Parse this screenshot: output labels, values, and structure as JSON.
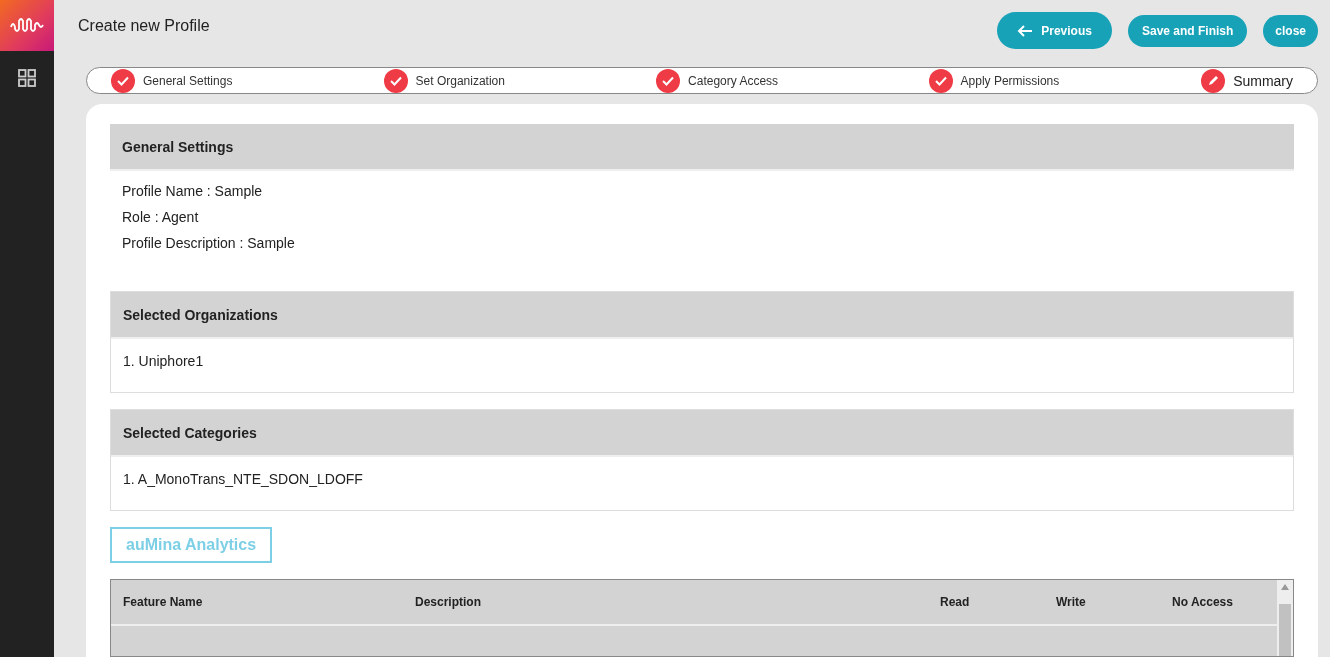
{
  "header": {
    "title": "Create new Profile",
    "buttons": [
      {
        "kind": "back",
        "label": "Previous"
      },
      {
        "kind": "plain",
        "label": "Save and Finish"
      },
      {
        "kind": "plain",
        "label": "close"
      }
    ]
  },
  "stepper": [
    {
      "label": "General Settings",
      "kind": "done",
      "selected": false
    },
    {
      "label": "Set Organization",
      "kind": "done",
      "selected": false
    },
    {
      "label": "Category Access",
      "kind": "done",
      "selected": false
    },
    {
      "label": "Apply Permissions",
      "kind": "done",
      "selected": false
    },
    {
      "label": "Summary",
      "kind": "edit",
      "selected": true
    }
  ],
  "general_settings": {
    "title": "General Settings",
    "fields": [
      {
        "label": "Profile Name :",
        "value": "Sample"
      },
      {
        "label": "Role :",
        "value": "Agent"
      },
      {
        "label": "Profile Description :",
        "value": "Sample"
      }
    ]
  },
  "organizations": {
    "title": "Selected Organizations",
    "items": [
      "1. Uniphore1"
    ]
  },
  "categories": {
    "title": "Selected Categories",
    "items": [
      "1. A_MonoTrans_NTE_SDON_LDOFF"
    ]
  },
  "product_tab": {
    "label": "auMina Analytics"
  },
  "table": {
    "columns": [
      "Feature Name",
      "Description",
      "Read",
      "Write",
      "No Access"
    ]
  }
}
